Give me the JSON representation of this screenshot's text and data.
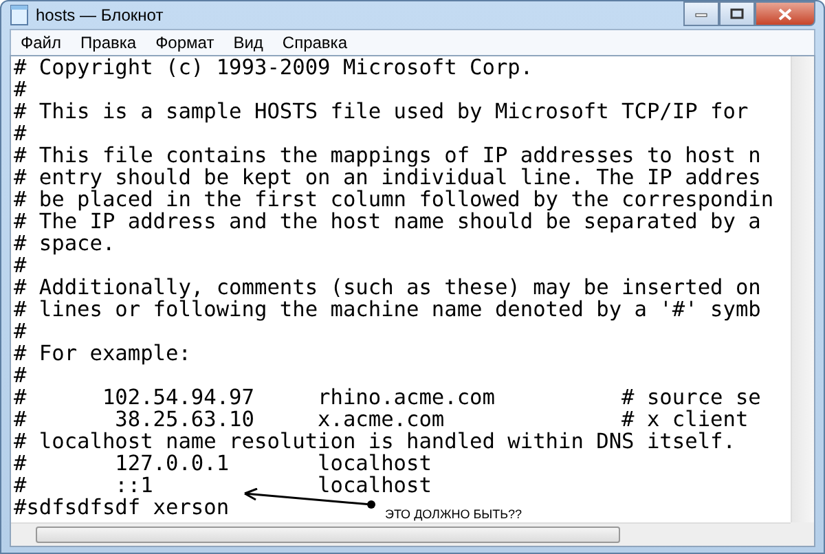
{
  "window": {
    "title": "hosts — Блокнот"
  },
  "menu": [
    "Файл",
    "Правка",
    "Формат",
    "Вид",
    "Справка"
  ],
  "document": {
    "lines": [
      "# Copyright (c) 1993-2009 Microsoft Corp.",
      "#",
      "# This is a sample HOSTS file used by Microsoft TCP/IP for",
      "#",
      "# This file contains the mappings of IP addresses to host n",
      "# entry should be kept on an individual line. The IP addres",
      "# be placed in the first column followed by the correspondin",
      "# The IP address and the host name should be separated by a",
      "# space.",
      "#",
      "# Additionally, comments (such as these) may be inserted on",
      "# lines or following the machine name denoted by a '#' symb",
      "#",
      "# For example:",
      "#",
      "#      102.54.94.97     rhino.acme.com          # source se",
      "#       38.25.63.10     x.acme.com              # x client",
      "# localhost name resolution is handled within DNS itself.",
      "#       127.0.0.1       localhost",
      "#       ::1             localhost",
      "#sdfsdfsdf xerson"
    ]
  },
  "annotation": {
    "text": "ЭТО ДОЛЖНО БЫТЬ??"
  }
}
